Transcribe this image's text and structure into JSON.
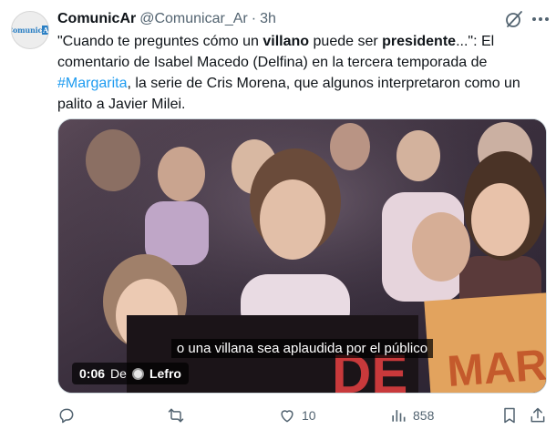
{
  "tweet": {
    "author": {
      "name": "ComunicAr",
      "handle": "@Comunicar_Ar",
      "separator": "·",
      "time": "3h",
      "avatar_logo_main": "Comunic",
      "avatar_logo_accent": "Ar"
    },
    "text": {
      "p1": "\"Cuando te preguntes cómo un ",
      "bold1": "villano",
      "p2": " puede ser ",
      "bold2": "presidente",
      "p3": "...\": El comentario de Isabel Macedo (Delfina) en la tercera temporada de ",
      "hashtag": "#Margarita",
      "p4": ", la serie de Cris Morena, que algunos interpretaron como un palito a Javier Milei."
    },
    "media": {
      "caption": "o una villana sea aplaudida por el público",
      "duration": "0:06",
      "source_prefix": "De",
      "source_name": "Lefro"
    },
    "actions": {
      "reply_count": "",
      "retweet_count": "",
      "like_count": "10",
      "views_count": "858"
    }
  },
  "icons": {
    "grok": "grok-icon",
    "more": "more-icon",
    "reply": "reply-icon",
    "retweet": "retweet-icon",
    "like": "heart-icon",
    "views": "views-icon",
    "bookmark": "bookmark-icon",
    "share": "share-icon"
  },
  "colors": {
    "text": "#0f1419",
    "muted": "#536471",
    "link": "#1d9bf0"
  }
}
